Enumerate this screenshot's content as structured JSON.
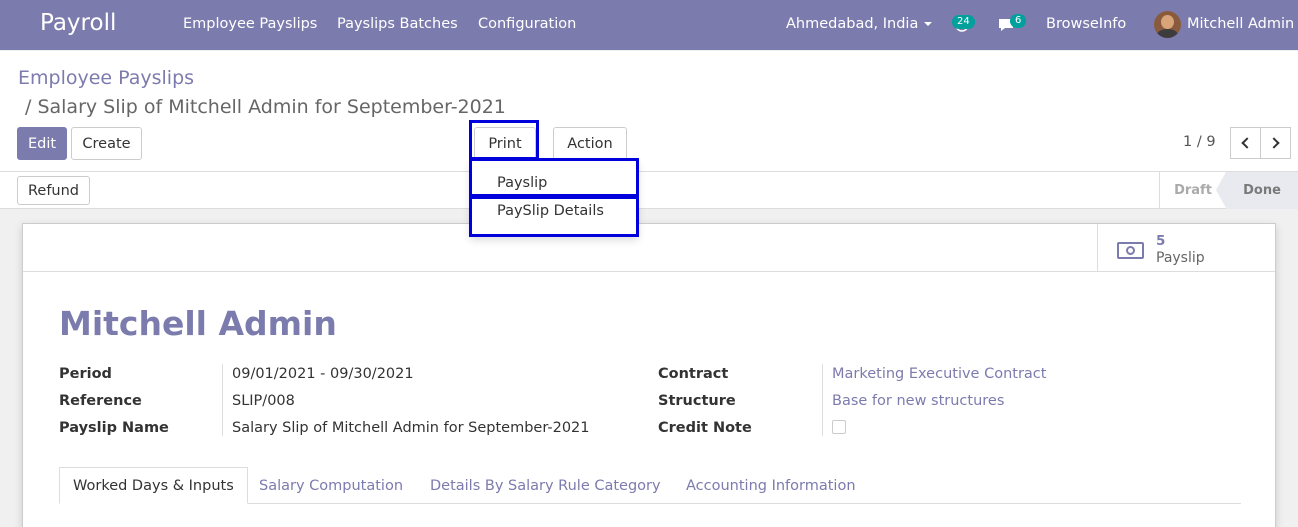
{
  "navbar": {
    "app_name": "Payroll",
    "menus": [
      "Employee Payslips",
      "Payslips Batches",
      "Configuration"
    ],
    "company": "Ahmedabad, India",
    "activity_count": "24",
    "message_count": "6",
    "browse": "BrowseInfo",
    "user": "Mitchell Admin",
    "color": "#7c7bad"
  },
  "breadcrumb": {
    "parent": "Employee Payslips",
    "current": "/ Salary Slip of Mitchell Admin for September-2021"
  },
  "buttons": {
    "edit": "Edit",
    "create": "Create",
    "print": "Print",
    "action": "Action",
    "refund": "Refund"
  },
  "print_menu": {
    "items": [
      "Payslip",
      "PaySlip Details"
    ]
  },
  "pager": {
    "value": "1 / 9"
  },
  "statusbar": {
    "states": [
      "Draft",
      "Done"
    ],
    "current": "Done"
  },
  "stat_button": {
    "value": "5",
    "label": "Payslip"
  },
  "form": {
    "employee": "Mitchell Admin",
    "left": [
      {
        "label": "Period",
        "value": "09/01/2021 - 09/30/2021"
      },
      {
        "label": "Reference",
        "value": "SLIP/008"
      },
      {
        "label": "Payslip Name",
        "value": "Salary Slip of Mitchell Admin for September-2021"
      }
    ],
    "right": [
      {
        "label": "Contract",
        "value": "Marketing Executive Contract"
      },
      {
        "label": "Structure",
        "value": "Base for new structures"
      },
      {
        "label": "Credit Note",
        "value": ""
      }
    ]
  },
  "tabs": [
    "Worked Days & Inputs",
    "Salary Computation",
    "Details By Salary Rule Category",
    "Accounting Information"
  ],
  "highlight_color": "#0000dd"
}
